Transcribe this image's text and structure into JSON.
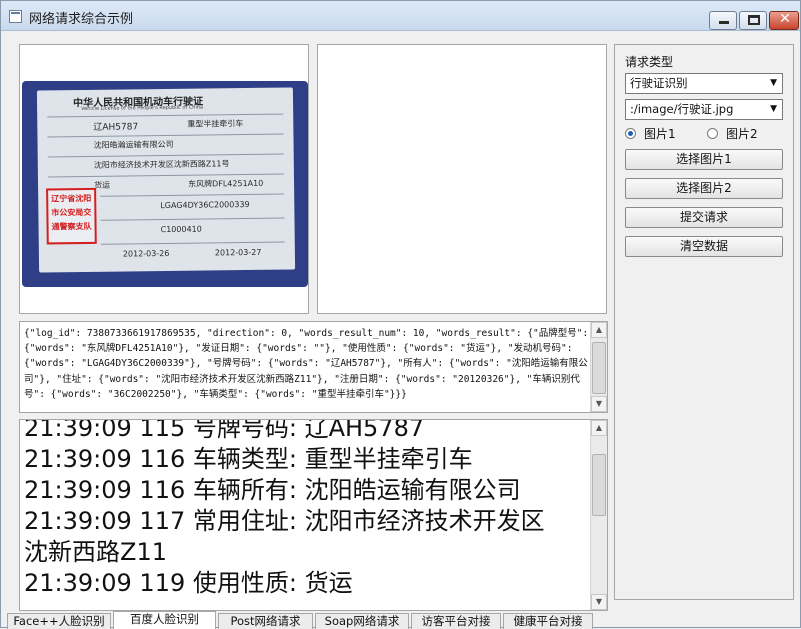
{
  "window": {
    "title": "网络请求综合示例"
  },
  "license_card": {
    "title": "中华人民共和国机动车行驶证",
    "subtitle": "Vehicle License of the People's Republic of China",
    "plate": "辽AH5787",
    "vehicle_type": "重型半挂牵引车",
    "owner": "沈阳皓瀚运输有限公司",
    "address": "沈阳市经济技术开发区沈新西路Z11号",
    "use_character": "货运",
    "model": "东风牌DFL4251A10",
    "vin": "LGAG4DY36C2000339",
    "engine_no": "C1000410",
    "register_date": "2012-03-26",
    "issue_date": "2012-03-27",
    "stamp_lines": [
      "辽宁省沈阳",
      "市公安局交",
      "通警察支队"
    ]
  },
  "json_output": "{\"log_id\": 738073366191786953​5, \"direction\": 0, \"words_result_num\": 10, \"words_result\": {\"品牌型号\": {\"words\": \"东风牌DFL4251A10\"}, \"发证日期\": {\"words\": \"\"}, \"使用性质\": {\"words\": \"货运\"}, \"发动机号码\": {\"words\": \"LGAG4DY36C2000339\"}, \"号牌号码\": {\"words\": \"辽AH5787\"}, \"所有人\": {\"words\": \"沈阳皓运输有限公司\"}, \"住址\": {\"words\": \"沈阳市经济技术开发区沈新西路Z11\"}, \"注册日期\": {\"words\": \"20120326\"}, \"车辆识别代号\": {\"words\": \"36C2002250\"}, \"车辆类型\": {\"words\": \"重型半挂牵引车\"}}}",
  "log_lines": [
    "21:39:09 115  号牌号码: 辽AH5787",
    "21:39:09 116  车辆类型: 重型半挂牵引车",
    "21:39:09 116  车辆所有: 沈阳皓运输有限公司",
    "21:39:09 117  常用住址: 沈阳市经济技术开发区",
    "沈新西路Z11",
    "21:39:09 119  使用性质: 货运"
  ],
  "side": {
    "request_type_label": "请求类型",
    "request_type_value": "行驶证识别",
    "image_path_value": ":/image/行驶证.jpg",
    "radio1_label": "图片1",
    "radio2_label": "图片2",
    "radio_selected": "图片1",
    "btn_select1": "选择图片1",
    "btn_select2": "选择图片2",
    "btn_submit": "提交请求",
    "btn_clear": "清空数据"
  },
  "tabs": [
    "Face++人脸识别",
    "百度人脸识别",
    "Post网络请求",
    "Soap网络请求",
    "访客平台对接",
    "健康平台对接"
  ],
  "active_tab": "百度人脸识别",
  "icons": {
    "app": "window-app-icon",
    "minimize": "minimize-icon",
    "maximize": "maximize-icon",
    "close": "close-icon",
    "dropdown": "chevron-down-icon"
  }
}
